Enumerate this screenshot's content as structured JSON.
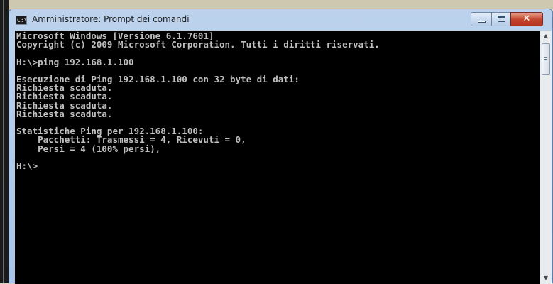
{
  "window": {
    "title": "Amministratore: Prompt dei comandi",
    "icon_label": "C:\\",
    "controls": {
      "minimize_icon": "minimize-icon",
      "maximize_icon": "maximize-icon",
      "close_glyph": "✕"
    }
  },
  "console": {
    "lines": [
      "Microsoft Windows [Versione 6.1.7601]",
      "Copyright (c) 2009 Microsoft Corporation. Tutti i diritti riservati.",
      "",
      "H:\\>ping 192.168.1.100",
      "",
      "Esecuzione di Ping 192.168.1.100 con 32 byte di dati:",
      "Richiesta scaduta.",
      "Richiesta scaduta.",
      "Richiesta scaduta.",
      "Richiesta scaduta.",
      "",
      "Statistiche Ping per 192.168.1.100:",
      "    Pacchetti: Trasmessi = 4, Ricevuti = 0,",
      "    Persi = 4 (100% persi),",
      "",
      "H:\\>"
    ]
  },
  "scrollbar": {
    "up_arrow": "▲",
    "down_arrow": "▼"
  },
  "colors": {
    "console_bg": "#000000",
    "console_text": "#c0c0c0",
    "close_button": "#c2432b"
  }
}
